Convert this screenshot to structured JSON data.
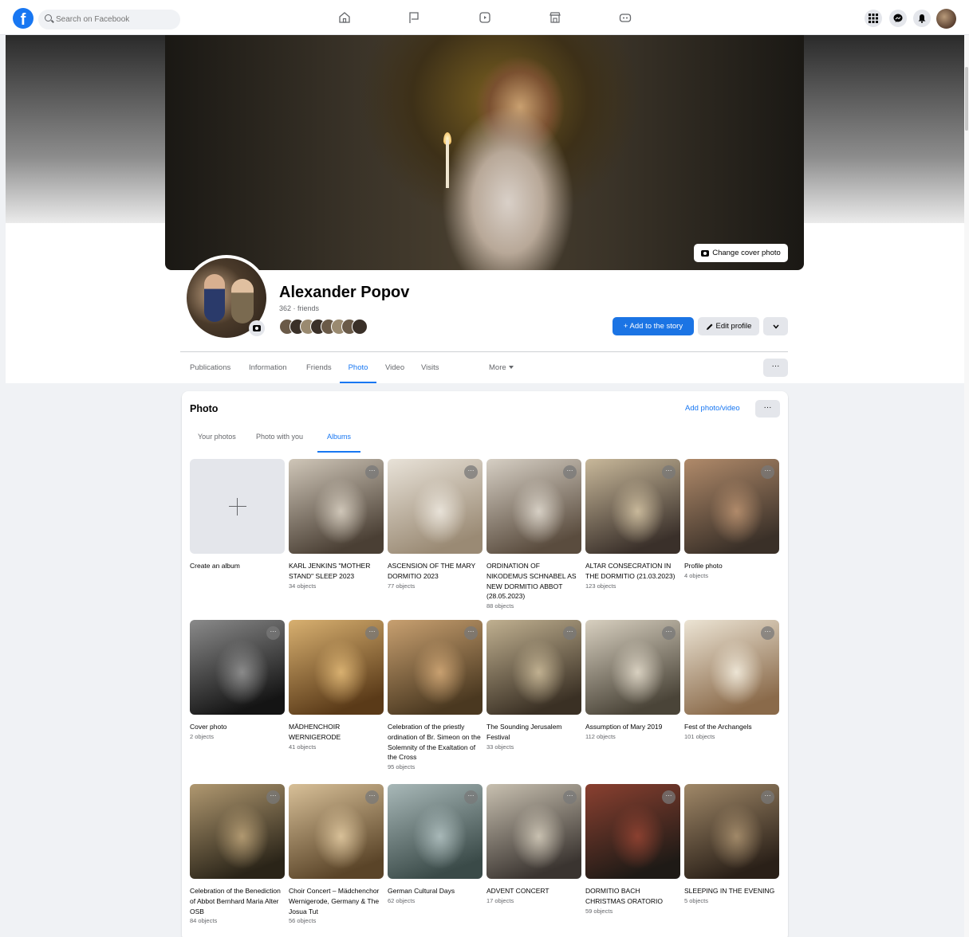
{
  "topbar": {
    "logo": "f",
    "search_placeholder": "Search on Facebook"
  },
  "cover": {
    "change_cover_label": "Change cover photo"
  },
  "profile": {
    "name": "Alexander Popov",
    "friends": "362 · friends",
    "add_story_label": "+ Add to the story",
    "edit_profile_label": "Edit profile"
  },
  "tabs": [
    {
      "label": "Publications"
    },
    {
      "label": "Information"
    },
    {
      "label": "Friends"
    },
    {
      "label": "Photo"
    },
    {
      "label": "Video"
    },
    {
      "label": "Visits"
    },
    {
      "label": "More"
    }
  ],
  "photo_section": {
    "title": "Photo",
    "add_label": "Add photo/video",
    "subtabs": [
      {
        "label": "Your photos"
      },
      {
        "label": "Photo with you"
      },
      {
        "label": "Albums"
      }
    ],
    "create_album_label": "Create an album",
    "albums": [
      {
        "title": "KARL JENKINS \"MOTHER STAND\" SLEEP 2023",
        "count": "34 objects",
        "color1": "#cfc6b8",
        "color2": "#4a3f34"
      },
      {
        "title": "ASCENSION OF THE MARY DORMITIO 2023",
        "count": "77 objects",
        "color1": "#e8e2d8",
        "color2": "#9a8a74"
      },
      {
        "title": "ORDINATION OF NIKODEMUS SCHNABEL AS NEW DORMITIO ABBOT (28.05.2023)",
        "count": "88 objects",
        "color1": "#d6cfc4",
        "color2": "#5a4c3e"
      },
      {
        "title": "ALTAR CONSECRATION IN THE DORMITIO (21.03.2023)",
        "count": "123 objects",
        "color1": "#c8b89a",
        "color2": "#3a302a"
      },
      {
        "title": "Profile photo",
        "count": "4 objects",
        "color1": "#b08a6a",
        "color2": "#3a3028"
      },
      {
        "title": "Cover photo",
        "count": "2 objects",
        "color1": "#8a8a8a",
        "color2": "#141414"
      },
      {
        "title": "MÄDHENCHOIR WERNIGERODE",
        "count": "41 objects",
        "color1": "#d8b070",
        "color2": "#5a3a18"
      },
      {
        "title": "Celebration of the priestly ordination of Br. Simeon on the Solemnity of the Exaltation of the Cross",
        "count": "95 objects",
        "color1": "#c8a070",
        "color2": "#4a3820"
      },
      {
        "title": "The Sounding Jerusalem Festival",
        "count": "33 objects",
        "color1": "#c0b090",
        "color2": "#3a3024"
      },
      {
        "title": "Assumption of Mary 2019",
        "count": "112 objects",
        "color1": "#d8d0c0",
        "color2": "#4a4438"
      },
      {
        "title": "Fest of the Archangels",
        "count": "101 objects",
        "color1": "#ece4d4",
        "color2": "#8a6a4a"
      },
      {
        "title": "Celebration of the Benediction of Abbot Bernhard Maria Alter OSB",
        "count": "84 objects",
        "color1": "#b09870",
        "color2": "#2a2418"
      },
      {
        "title": "Choir Concert – Mädchenchor Wernigerode, Germany & The Josua Tut",
        "count": "56 objects",
        "color1": "#d8c098",
        "color2": "#5a4428"
      },
      {
        "title": "German Cultural Days",
        "count": "62 objects",
        "color1": "#a8b8b8",
        "color2": "#3a4a48"
      },
      {
        "title": "ADVENT CONCERT",
        "count": "17 objects",
        "color1": "#c8c0b0",
        "color2": "#3a3430"
      },
      {
        "title": "DORMITIO BACH CHRISTMAS ORATORIO",
        "count": "59 objects",
        "color1": "#8a4030",
        "color2": "#1e1a16"
      },
      {
        "title": "SLEEPING IN THE EVENING",
        "count": "5 objects",
        "color1": "#a08868",
        "color2": "#2a2018"
      }
    ]
  },
  "colors": {
    "accent": "#1877f2",
    "background": "#f0f2f5"
  }
}
